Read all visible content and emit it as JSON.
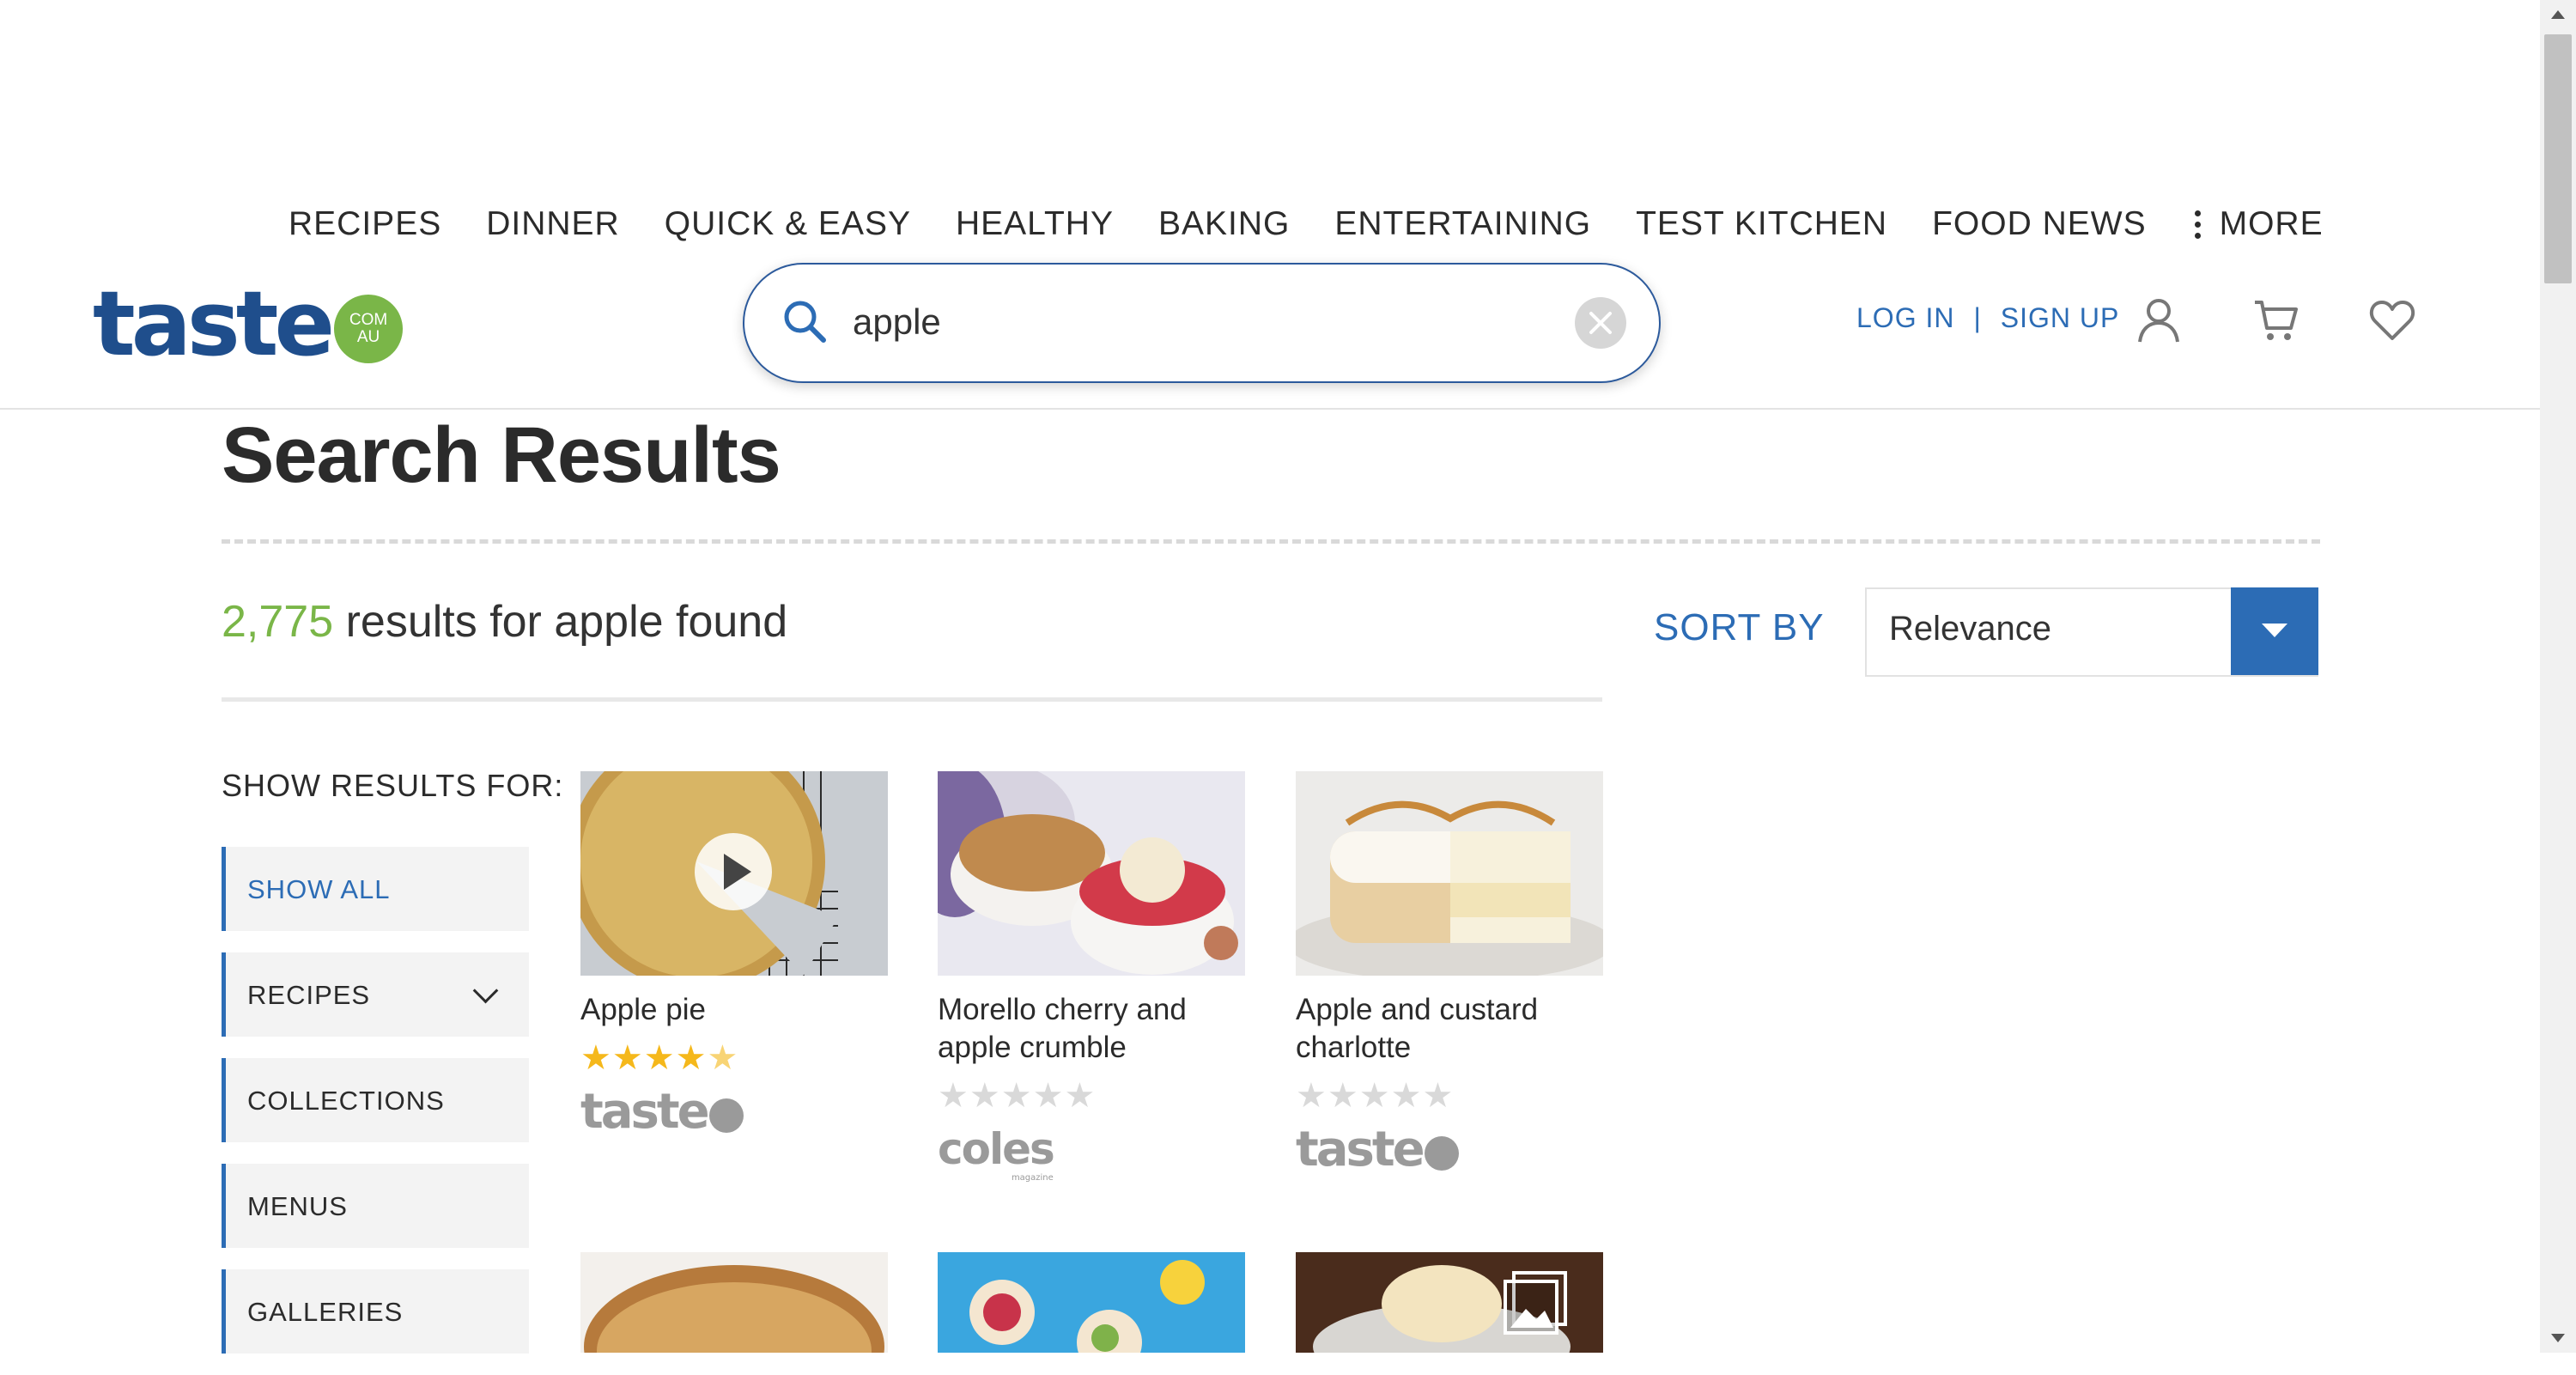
{
  "nav": {
    "items": [
      "RECIPES",
      "DINNER",
      "QUICK & EASY",
      "HEALTHY",
      "BAKING",
      "ENTERTAINING",
      "TEST KITCHEN",
      "FOOD NEWS"
    ],
    "more_label": "MORE"
  },
  "header": {
    "logo_text": "taste",
    "logo_badge_line1": "COM",
    "logo_badge_line2": "AU",
    "search_value": "apple",
    "login_label": "LOG IN",
    "separator": "|",
    "signup_label": "SIGN UP",
    "icons": [
      "search-icon",
      "clear-icon",
      "user-icon",
      "cart-icon",
      "heart-icon"
    ]
  },
  "page": {
    "title": "Search Results",
    "results_number": "2,775",
    "results_text": " results for apple found",
    "sort_label": "SORT BY",
    "sort_value": "Relevance"
  },
  "filters": {
    "title": "SHOW RESULTS FOR:",
    "items": [
      "SHOW ALL",
      "RECIPES",
      "COLLECTIONS",
      "MENUS",
      "GALLERIES"
    ]
  },
  "cards": [
    {
      "title": "Apple pie",
      "rating": 4.5,
      "brand": "taste",
      "has_video": true
    },
    {
      "title": "Morello cherry and apple crumble",
      "rating": 0,
      "brand": "coles",
      "brand_sub": "magazine"
    },
    {
      "title": "Apple and custard charlotte",
      "rating": 0,
      "brand": "taste"
    }
  ],
  "colors": {
    "brand_blue": "#1f4e8c",
    "link_blue": "#2c6cb5",
    "accent_green": "#7ab648",
    "star_yellow": "#f5b81b"
  }
}
